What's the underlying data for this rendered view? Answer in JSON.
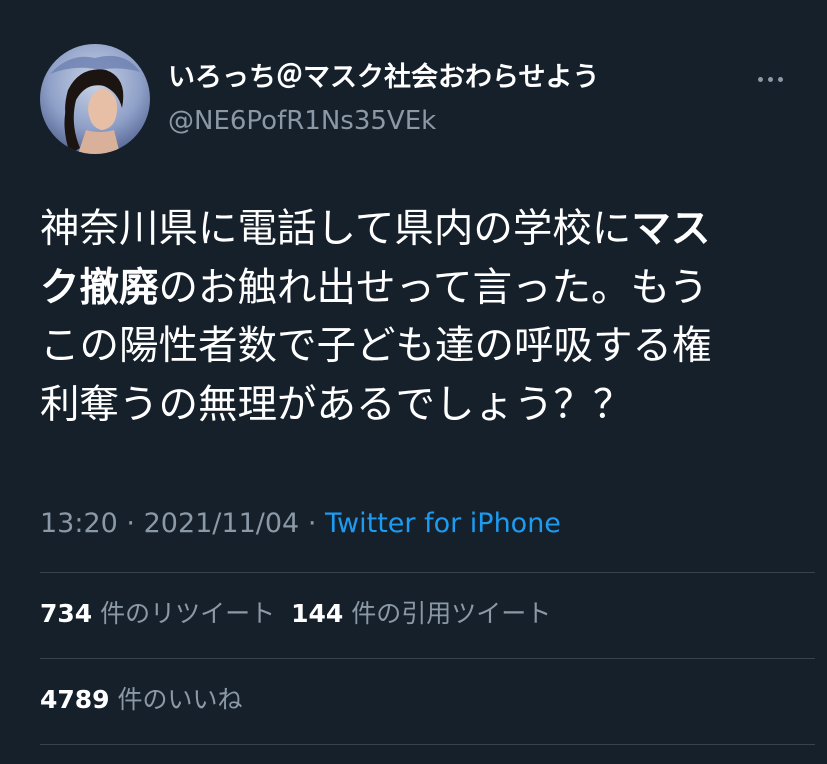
{
  "tweet": {
    "display_name": "いろっち＠マスク社会おわらせよう",
    "handle": "@NE6PofR1Ns35VEk",
    "text_lines": [
      [
        {
          "t": "神奈川県に電話して県内の学校に"
        },
        {
          "t": "マス",
          "b": true
        }
      ],
      [
        {
          "t": "ク撤廃",
          "b": true
        },
        {
          "t": "のお触れ出せって言った。もう"
        }
      ],
      [
        {
          "t": "この陽性者数で子ども達の呼吸する権"
        }
      ],
      [
        {
          "t": "利奪うの無理があるでしょう？？"
        }
      ]
    ],
    "time": "13:20",
    "date": "2021/11/04",
    "separator": "·",
    "source": "Twitter for iPhone",
    "retweets": {
      "count": "734",
      "label": "件のリツイート"
    },
    "quotes": {
      "count": "144",
      "label": "件の引用ツイート"
    },
    "likes": {
      "count": "4789",
      "label": "件のいいね"
    }
  },
  "icons": {
    "avatar": "profile-photo",
    "more": "more-dots-icon"
  },
  "colors": {
    "background": "#15202b",
    "text": "#ffffff",
    "muted": "#8b98a5",
    "link": "#1d9bf0",
    "divider": "#38444d"
  }
}
